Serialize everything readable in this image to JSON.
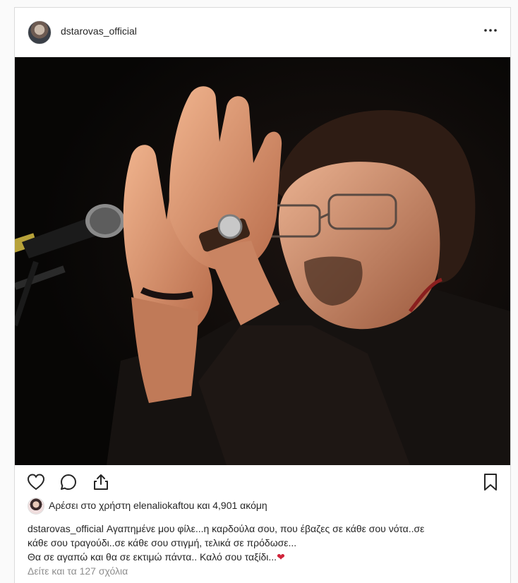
{
  "post": {
    "username": "dstarovas_official",
    "more_icon": "more-horizontal-icon",
    "photo_alt": "",
    "actions": {
      "like_icon": "heart-icon",
      "comment_icon": "comment-bubble-icon",
      "share_icon": "share-upload-icon",
      "save_icon": "bookmark-icon"
    },
    "likes": {
      "text": "Αρέσει στο χρήστη elenaliokaftou και 4,901 ακόμη"
    },
    "caption": {
      "user": "dstarovas_official",
      "line1": "Αγαπημένε μου φίλε...η καρδούλα σου, που έβαζες σε κάθε σου νότα..σε",
      "line2": "κάθε σου τραγούδι..σε κάθε σου στιγμή, τελικά σε πρόδωσε...",
      "line3": "Θα σε αγαπώ και θα σε εκτιμώ πάντα.. Καλό σου ταξίδι...",
      "emoji": "❤"
    },
    "comments_link": "Δείτε και τα 127 σχόλια"
  },
  "colors": {
    "text": "#262626",
    "muted": "#8e8e8e",
    "border": "#dbdbdb",
    "heart": "#d0243b"
  }
}
